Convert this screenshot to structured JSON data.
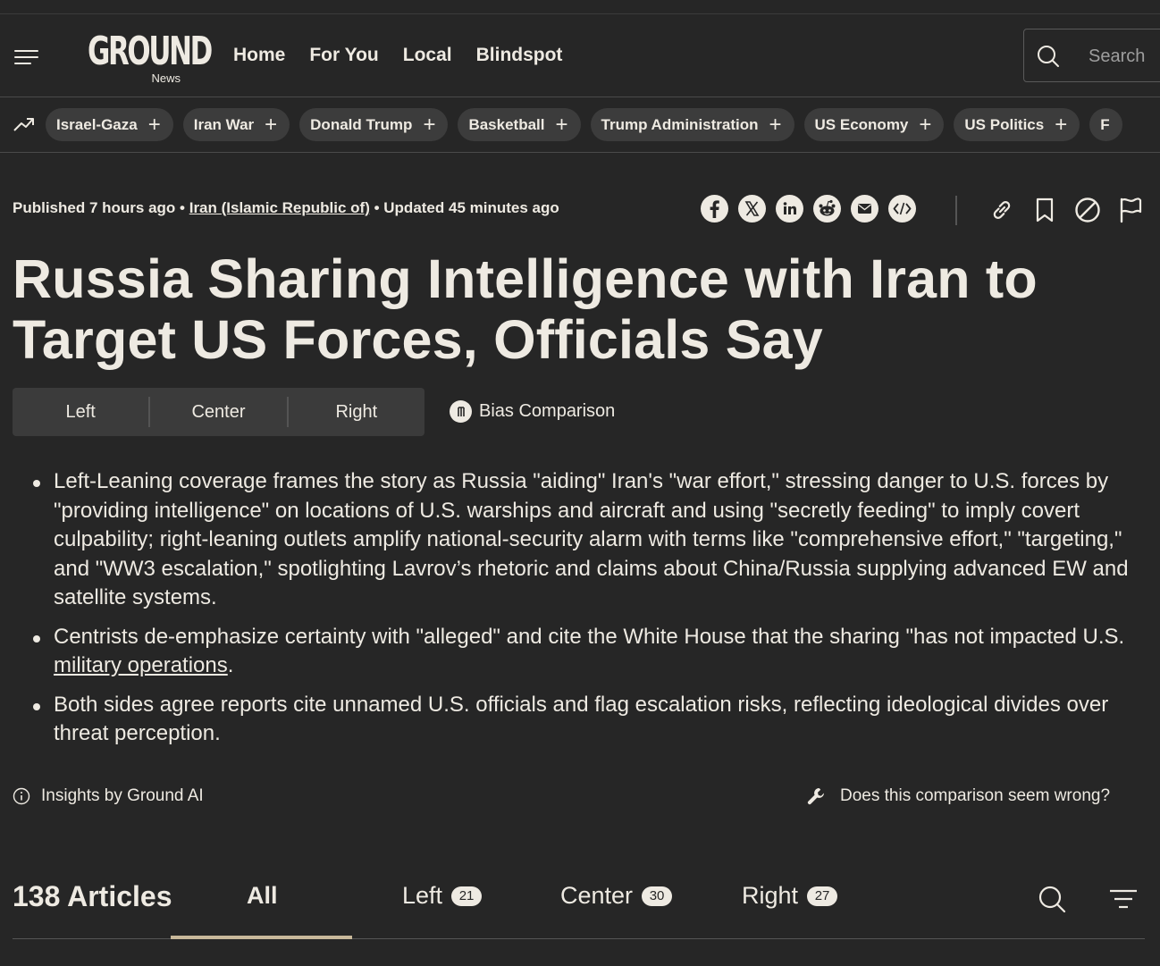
{
  "header": {
    "logo_word": "GROUND",
    "logo_sub": "News",
    "nav": [
      "Home",
      "For You",
      "Local",
      "Blindspot"
    ],
    "search_placeholder": "Search"
  },
  "topics": [
    "Israel-Gaza",
    "Iran War",
    "Donald Trump",
    "Basketball",
    "Trump Administration",
    "US Economy",
    "US Politics",
    "F"
  ],
  "article": {
    "meta_published": "Published 7 hours ago",
    "meta_sep": " • ",
    "meta_location": "Iran (Islamic Republic of)",
    "meta_updated": " • Updated 45 minutes ago",
    "title": "Russia Sharing Intelligence with Iran to Target US Forces, Officials Say",
    "share_icons": [
      "facebook-icon",
      "x-icon",
      "linkedin-icon",
      "reddit-icon",
      "email-icon",
      "embed-icon"
    ],
    "action_icons": [
      "link-icon",
      "bookmark-icon",
      "block-icon",
      "flag-icon"
    ]
  },
  "bias": {
    "tabs": [
      "Left",
      "Center",
      "Right"
    ],
    "comparison_label": "Bias Comparison",
    "bullets": {
      "b1": "Left-Leaning coverage frames the story as Russia \"aiding\" Iran's \"war effort,\" stressing danger to U.S. forces by \"providing intelligence\" on locations of U.S. warships and aircraft and using \"secretly feeding\" to imply covert culpability; right-leaning outlets amplify national-security alarm with terms like \"comprehensive effort,\" \"targeting,\" and \"WW3 escalation,\" spotlighting Lavrov’s rhetoric and claims about China/Russia supplying advanced EW and satellite systems.",
      "b2_pre": "Centrists de-emphasize certainty with \"alleged\" and cite the White House that the sharing \"has not impacted U.S. ",
      "b2_link": "military operations",
      "b2_post": ".",
      "b3": "Both sides agree reports cite unnamed U.S. officials and flag escalation risks, reflecting ideological divides over threat perception."
    },
    "insights_label": "Insights by Ground AI",
    "wrong_label": "Does this comparison seem wrong?"
  },
  "articles": {
    "count_label": "138 Articles",
    "tabs": [
      {
        "label": "All",
        "count": ""
      },
      {
        "label": "Left",
        "count": "21"
      },
      {
        "label": "Center",
        "count": "30"
      },
      {
        "label": "Right",
        "count": "27"
      }
    ],
    "active_tab": "All",
    "underline_color": "#c8b89a"
  }
}
